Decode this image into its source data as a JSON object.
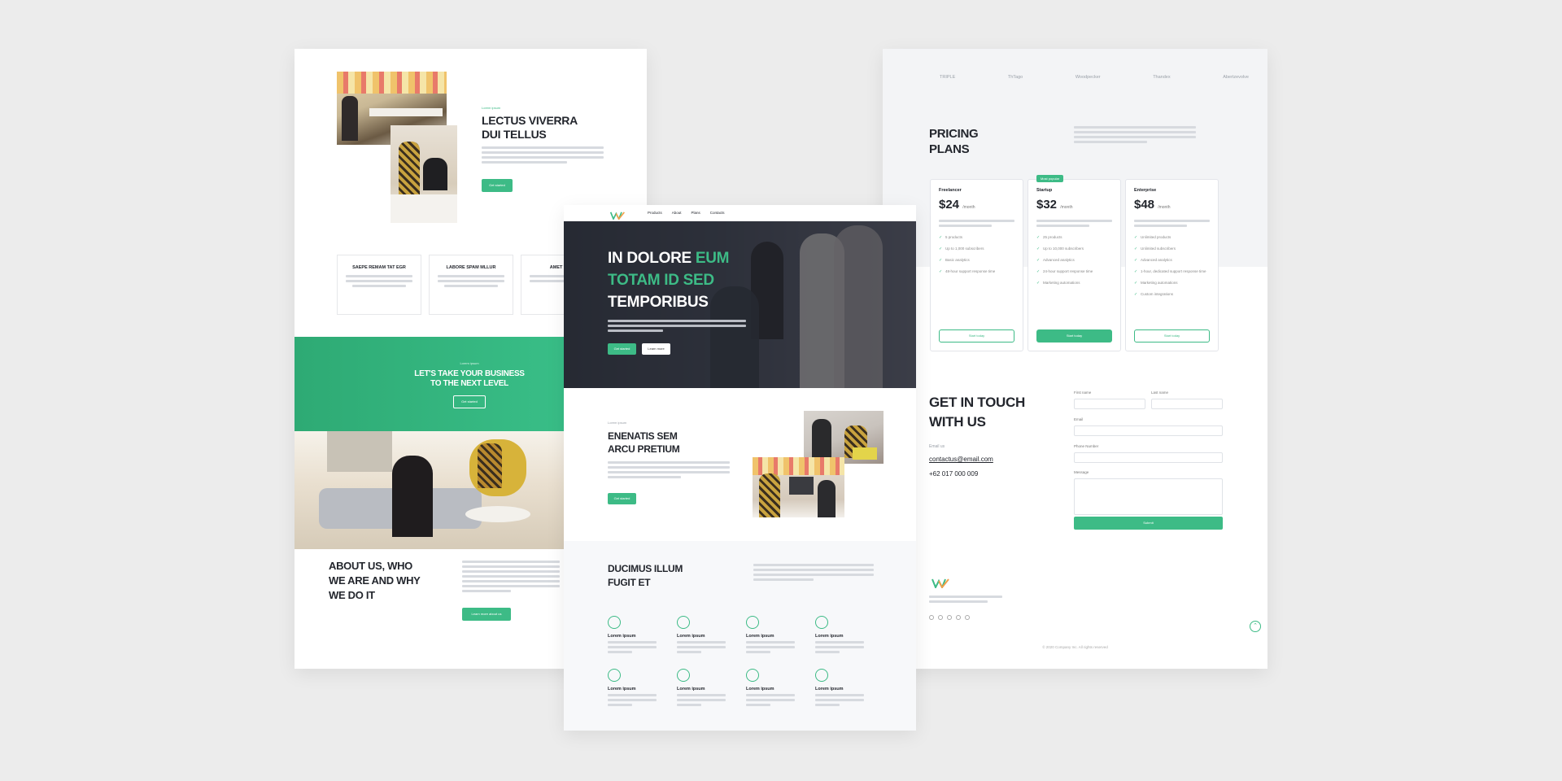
{
  "left": {
    "about_section": {
      "eyebrow": "Lorem ipsum",
      "title_line1": "LECTUS VIVERRA",
      "title_line2": "DUI TELLUS",
      "button": "Get started"
    },
    "feature_cards": [
      {
        "title": "SAEPE REMAM TAT EGR"
      },
      {
        "title": "LABORE SPAM MLLUR"
      },
      {
        "title": "AMET TCUR"
      }
    ],
    "cta": {
      "eyebrow": "Lorem ipsum",
      "title_line1": "LET'S TAKE YOUR BUSINESS",
      "title_line2": "TO THE NEXT LEVEL",
      "button": "Get started"
    },
    "about_us": {
      "title_line1": "ABOUT US, WHO",
      "title_line2": "WE ARE AND WHY",
      "title_line3": "WE DO IT",
      "button": "Learn more about us"
    }
  },
  "center": {
    "nav": [
      "Products",
      "About",
      "Plans",
      "Contacts"
    ],
    "hero": {
      "title_a": "IN DOLORE ",
      "title_b": "EUM",
      "title_c": "TOTAM ID SED",
      "title_d": "TEMPORIBUS",
      "primary_button": "Get started",
      "secondary_button": "Learn more"
    },
    "section2": {
      "eyebrow": "Lorem ipsum",
      "title_line1": "ENENATIS SEM",
      "title_line2": "ARCU PRETIUM",
      "button": "Get started"
    },
    "section3": {
      "title_line1": "DUCIMUS ILLUM",
      "title_line2": "FUGIT ET",
      "features": [
        {
          "title": "Lorem ipsum"
        },
        {
          "title": "Lorem ipsum"
        },
        {
          "title": "Lorem ipsum"
        },
        {
          "title": "Lorem ipsum"
        },
        {
          "title": "Lorem ipsum"
        },
        {
          "title": "Lorem ipsum"
        },
        {
          "title": "Lorem ipsum"
        },
        {
          "title": "Lorem ipsum"
        }
      ]
    }
  },
  "right": {
    "logos": [
      "TRIPLE",
      "ThTago",
      "Woodpecker",
      "Thandex",
      "Abertzevolve"
    ],
    "pricing": {
      "title_line1": "PRICING",
      "title_line2": "PLANS",
      "popular_badge": "Most popular",
      "plans": [
        {
          "name": "Freelancer",
          "price": "$24",
          "period": "/month",
          "button": "Start today",
          "features": [
            "5 products",
            "Up to 1,000 subscribers",
            "Basic analytics",
            "48-hour support response time"
          ]
        },
        {
          "name": "Startup",
          "price": "$32",
          "period": "/month",
          "button": "Start today",
          "features": [
            "25 products",
            "Up to 10,000 subscribers",
            "Advanced analytics",
            "24-hour support response time",
            "Marketing automations"
          ]
        },
        {
          "name": "Enterprise",
          "price": "$48",
          "period": "/month",
          "button": "Start today",
          "features": [
            "Unlimited products",
            "Unlimited subscribers",
            "Advanced analytics",
            "1-hour, dedicated support response time",
            "Marketing automations",
            "Custom integrations"
          ]
        }
      ]
    },
    "contact": {
      "title_line1": "GET IN TOUCH",
      "title_line2": "WITH US",
      "label": "Email us",
      "email": "contactus@email.com",
      "phone": "+62 017 000 009",
      "fields": {
        "first": "First name",
        "last": "Last name",
        "email": "Email",
        "phone": "Phone Number",
        "message": "Message"
      },
      "submit": "Submit"
    },
    "copyright": "© 2020 Company Inc. All rights reserved"
  },
  "colors": {
    "accent": "#3dbb86",
    "dark": "#23262d",
    "background": "#ececec"
  }
}
